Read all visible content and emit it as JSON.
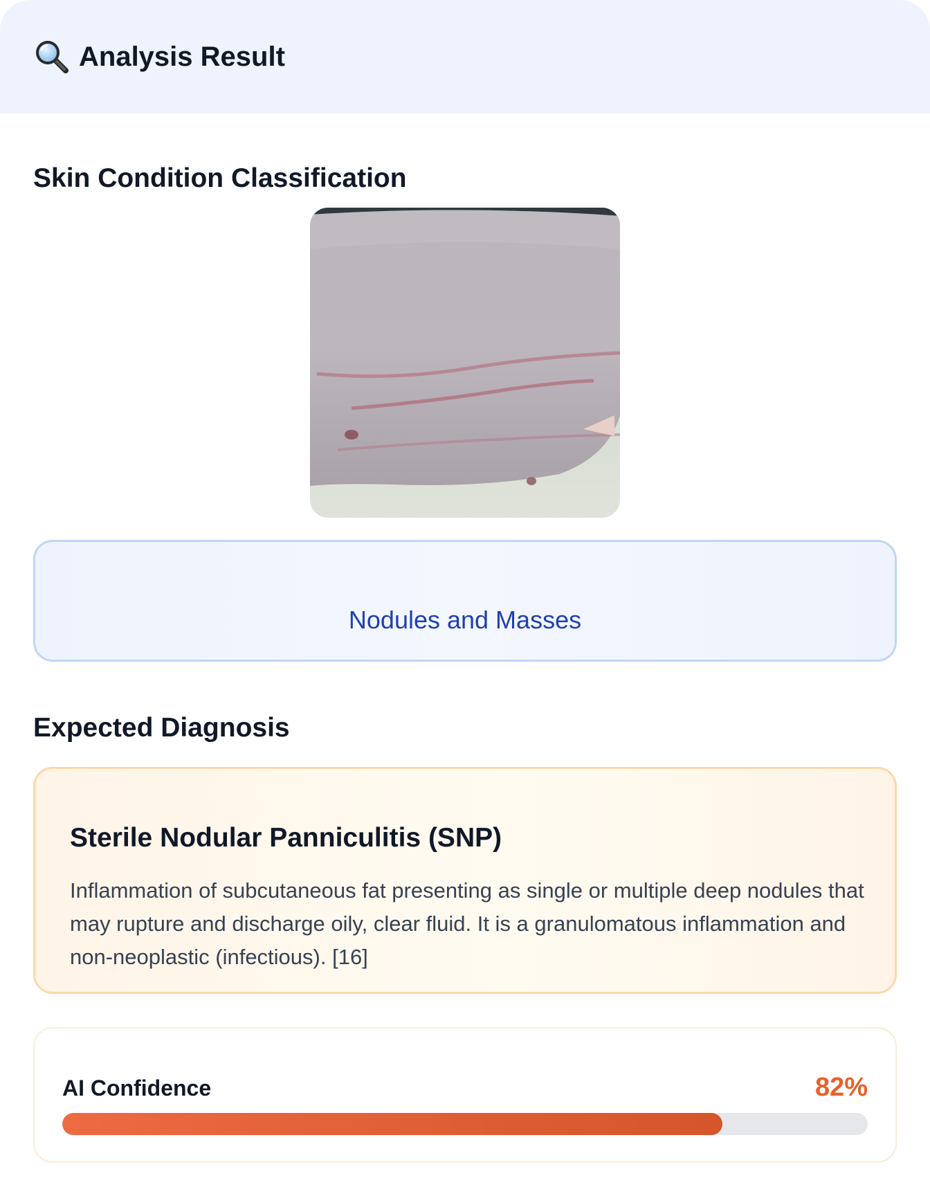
{
  "header": {
    "icon": "magnifier-icon",
    "title": "Analysis Result"
  },
  "classification": {
    "section_title": "Skin Condition Classification",
    "image": "skin-photo",
    "label": "Nodules and Masses"
  },
  "diagnosis": {
    "section_title": "Expected Diagnosis",
    "name": "Sterile Nodular Panniculitis (SNP)",
    "description": "Inflammation of subcutaneous fat presenting as single or multiple deep nodules that may rupture and discharge oily, clear fluid. It is a granulomatous inflammation and non-neoplastic (infectious). [16]"
  },
  "confidence": {
    "label": "AI Confidence",
    "value_text": "82%",
    "value": 0.82
  },
  "colors": {
    "accent": "#e8602c",
    "class_text": "#1e40af",
    "header_bg": "#eef3fd"
  }
}
